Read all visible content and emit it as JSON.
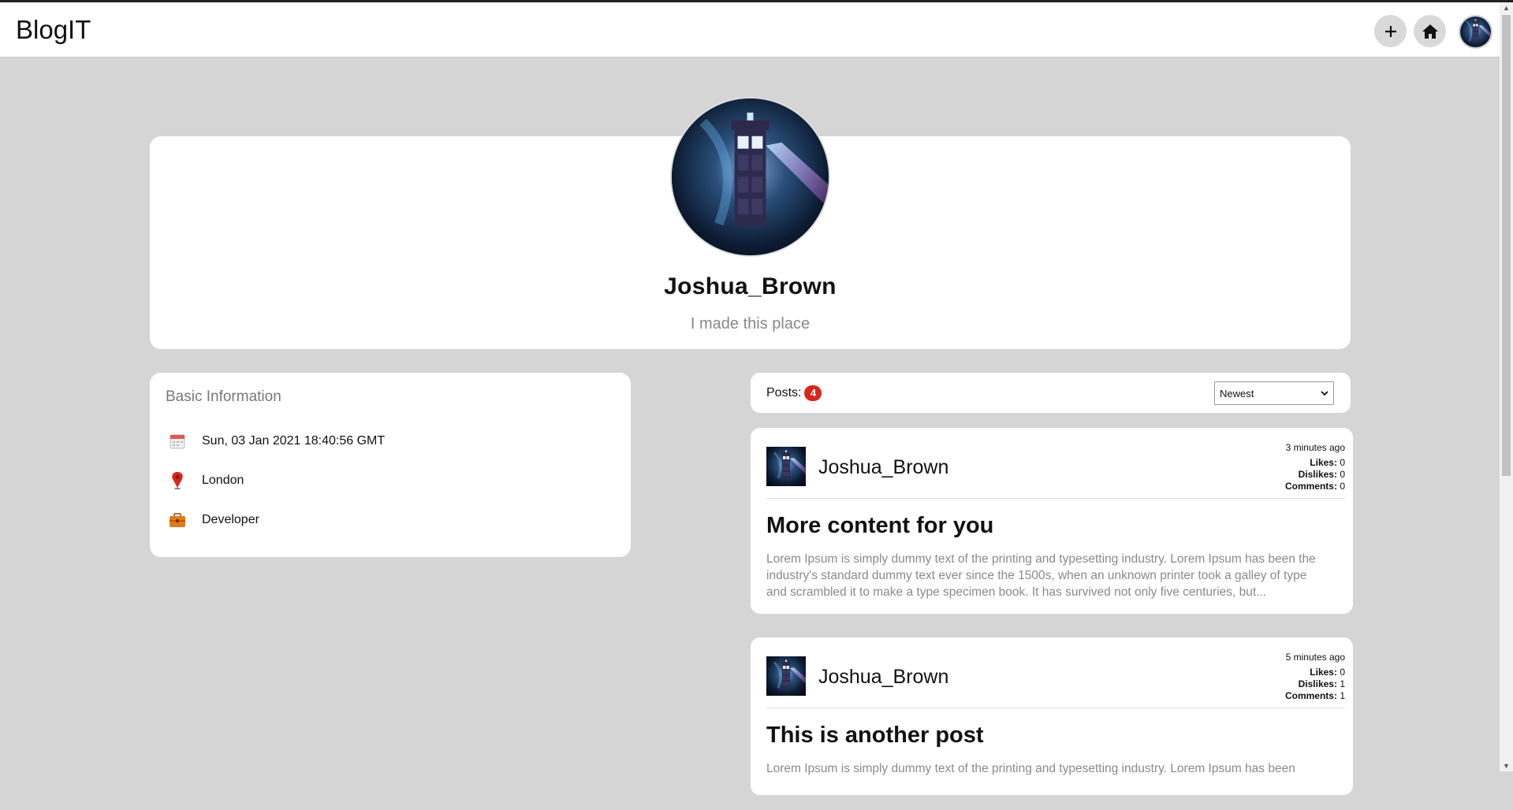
{
  "brand": "BlogIT",
  "nav": {
    "add_icon": "plus-icon",
    "home_icon": "home-icon"
  },
  "profile": {
    "name": "Joshua_Brown",
    "bio": "I made this place"
  },
  "basic_info": {
    "title": "Basic Information",
    "items": [
      {
        "icon": "calendar-icon",
        "text": "Sun, 03 Jan 2021 18:40:56 GMT"
      },
      {
        "icon": "location-pin-icon",
        "text": "London"
      },
      {
        "icon": "briefcase-icon",
        "text": "Developer"
      }
    ]
  },
  "posts_bar": {
    "label": "Posts:",
    "count": "4",
    "sort_selected": "Newest"
  },
  "posts": [
    {
      "author": "Joshua_Brown",
      "time": "3 minutes ago",
      "likes_label": "Likes:",
      "likes": "0",
      "dislikes_label": "Dislikes:",
      "dislikes": "0",
      "comments_label": "Comments:",
      "comments": "0",
      "title": "More content for you",
      "body": "Lorem Ipsum is simply dummy text of the printing and typesetting industry. Lorem Ipsum has been the industry's standard dummy text ever since the 1500s, when an unknown printer took a galley of type and scrambled it to make a type specimen book. It has survived not only five centuries, but..."
    },
    {
      "author": "Joshua_Brown",
      "time": "5 minutes ago",
      "likes_label": "Likes:",
      "likes": "0",
      "dislikes_label": "Dislikes:",
      "dislikes": "1",
      "comments_label": "Comments:",
      "comments": "1",
      "title": "This is another post",
      "body": "Lorem Ipsum is simply dummy text of the printing and typesetting industry. Lorem Ipsum has been"
    }
  ],
  "colors": {
    "background": "#d5d5d5",
    "badge": "#d9261c"
  }
}
